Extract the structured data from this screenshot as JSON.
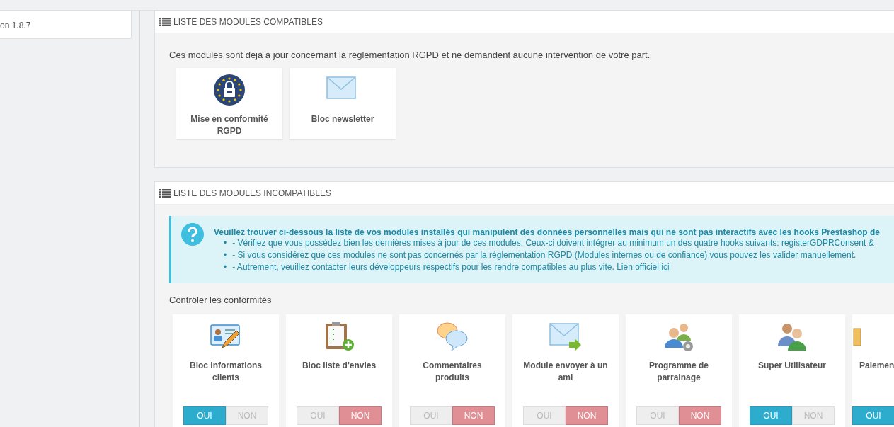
{
  "sidebar": {
    "version_text": "on 1.8.7"
  },
  "compatible_panel": {
    "title": "LISTE DES MODULES COMPATIBLES",
    "description": "Ces modules sont déjà à jour concernant la règlementation RGPD et ne demandent aucune intervention de votre part.",
    "modules": [
      {
        "name": "Mise en conformité RGPD",
        "kind": "gdpr"
      },
      {
        "name": "Bloc newsletter",
        "kind": "mail"
      }
    ]
  },
  "incompatible_panel": {
    "title": "LISTE DES MODULES INCOMPATIBLES",
    "alert": {
      "heading": "Veuillez trouver ci-dessous la liste de vos modules installés qui manipulent des données personnelles mais qui ne sont pas interactifs avec les hooks Prestashop de",
      "bullets": [
        {
          "marker": "•",
          "text": "- Vérifiez que vous possédez bien les dernières mises à jour de ces modules. Ceux-ci doivent intégrer au minimum un des quatre hooks suivants: registerGDPRConsent &"
        },
        {
          "marker": "•",
          "text": "- Si vous considérez que ces modules ne sont pas concernés par la réglementation RGPD (Modules internes ou de confiance) vous pouvez les valider manuellement."
        },
        {
          "marker": "•",
          "text": "- Autrement, veuillez contacter leurs développeurs respectifs pour les rendre compatibles au plus vite. Lien officiel"
        }
      ],
      "link": "ici"
    },
    "section_label": "Contrôler les conformités",
    "modules": [
      {
        "name": "Bloc informations clients",
        "kind": "card",
        "options": [
          {
            "label": "OUI",
            "selected": true
          },
          {
            "label": "NON",
            "selected": false
          }
        ]
      },
      {
        "name": "Bloc liste d'envies",
        "kind": "clipboard",
        "options": [
          {
            "label": "OUI",
            "selected": false
          },
          {
            "label": "NON",
            "selected": true
          }
        ]
      },
      {
        "name": "Commentaires produits",
        "kind": "bubbles",
        "options": [
          {
            "label": "OUI",
            "selected": false
          },
          {
            "label": "NON",
            "selected": true
          }
        ]
      },
      {
        "name": "Module envoyer à un ami",
        "kind": "mailsend",
        "options": [
          {
            "label": "OUI",
            "selected": false
          },
          {
            "label": "NON",
            "selected": true
          }
        ]
      },
      {
        "name": "Programme de parrainage",
        "kind": "people",
        "options": [
          {
            "label": "OUI",
            "selected": false
          },
          {
            "label": "NON",
            "selected": true
          }
        ]
      },
      {
        "name": "Super Utilisateur",
        "kind": "users",
        "options": [
          {
            "label": "OUI",
            "selected": true
          },
          {
            "label": "NON",
            "selected": false
          }
        ]
      },
      {
        "name": "Paiemen",
        "kind": "box",
        "options": [
          {
            "label": "OUI",
            "selected": true
          }
        ]
      }
    ]
  }
}
